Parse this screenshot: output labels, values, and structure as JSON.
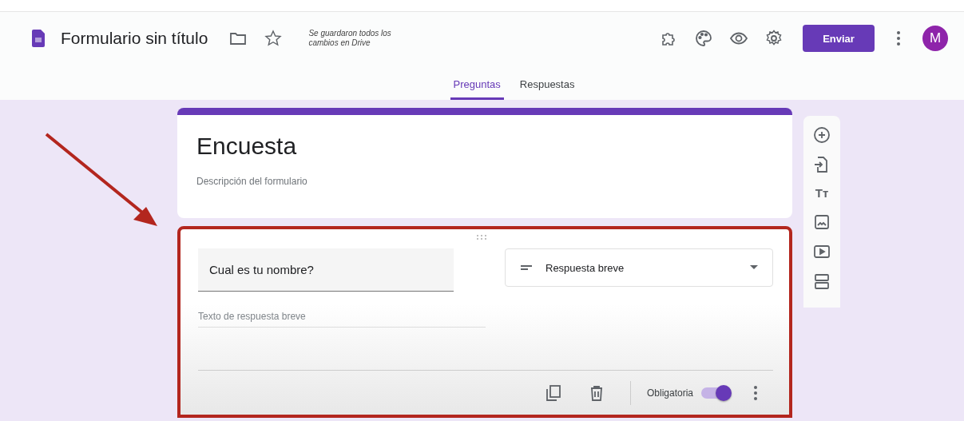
{
  "header": {
    "title": "Formulario sin título",
    "save_status": "Se guardaron todos los cambios en Drive",
    "send_button": "Enviar",
    "avatar": "M"
  },
  "tabs": [
    {
      "label": "Preguntas",
      "selected": true
    },
    {
      "label": "Respuestas",
      "selected": false
    }
  ],
  "form": {
    "title": "Encuesta",
    "description": "Descripción del formulario"
  },
  "question": {
    "title": "Cual es tu nombre?",
    "type": "Respuesta breve",
    "answer_placeholder": "Texto de respuesta breve",
    "required_label": "Obligatoria",
    "required": true,
    "highlighted": true
  },
  "side_tools": [
    {
      "kind": "add"
    },
    {
      "kind": "import"
    },
    {
      "kind": "text",
      "label": "Tт"
    },
    {
      "kind": "image"
    },
    {
      "kind": "video"
    },
    {
      "kind": "section"
    }
  ]
}
